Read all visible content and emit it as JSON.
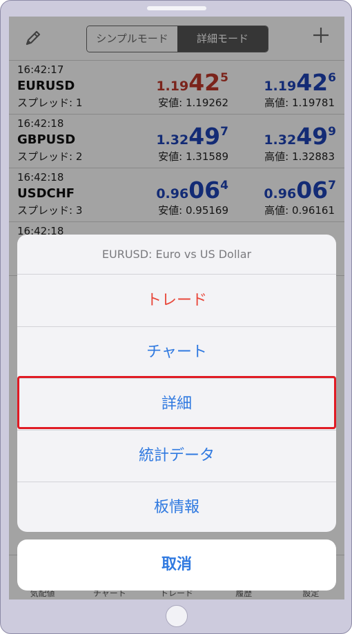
{
  "colors": {
    "bid_red": "#c0392b",
    "quote_blue": "#1f44b8",
    "action_blue": "#2f79e0",
    "destructive_red": "#e8473a",
    "highlight_red": "#e01b24"
  },
  "navbar": {
    "edit_icon": "pencil-icon",
    "mode_simple": "シンプルモード",
    "mode_detail": "詳細モード",
    "add_icon": "plus-icon"
  },
  "quotes": [
    {
      "time": "16:42:17",
      "symbol": "EURUSD",
      "spread": "スプレッド: 1",
      "bid": {
        "main": "1.19",
        "big": "42",
        "small": "5"
      },
      "ask": {
        "main": "1.19",
        "big": "42",
        "small": "6"
      },
      "low": "安値: 1.19262",
      "high": "高値: 1.19781"
    },
    {
      "time": "16:42:18",
      "symbol": "GBPUSD",
      "spread": "スプレッド: 2",
      "bid": {
        "main": "1.32",
        "big": "49",
        "small": "7"
      },
      "ask": {
        "main": "1.32",
        "big": "49",
        "small": "9"
      },
      "low": "安値: 1.31589",
      "high": "高値: 1.32883"
    },
    {
      "time": "16:42:18",
      "symbol": "USDCHF",
      "spread": "スプレッド: 3",
      "bid": {
        "main": "0.96",
        "big": "06",
        "small": "4"
      },
      "ask": {
        "main": "0.96",
        "big": "06",
        "small": "7"
      },
      "low": "安値: 0.95169",
      "high": "高値: 0.96161"
    },
    {
      "time": "16:42:18"
    }
  ],
  "tabbar": [
    "気配値",
    "チャート",
    "トレード",
    "履歴",
    "設定"
  ],
  "action_sheet": {
    "title": "EURUSD: Euro vs US Dollar",
    "items": [
      "トレード",
      "チャート",
      "詳細",
      "統計データ",
      "板情報"
    ],
    "cancel": "取消"
  }
}
